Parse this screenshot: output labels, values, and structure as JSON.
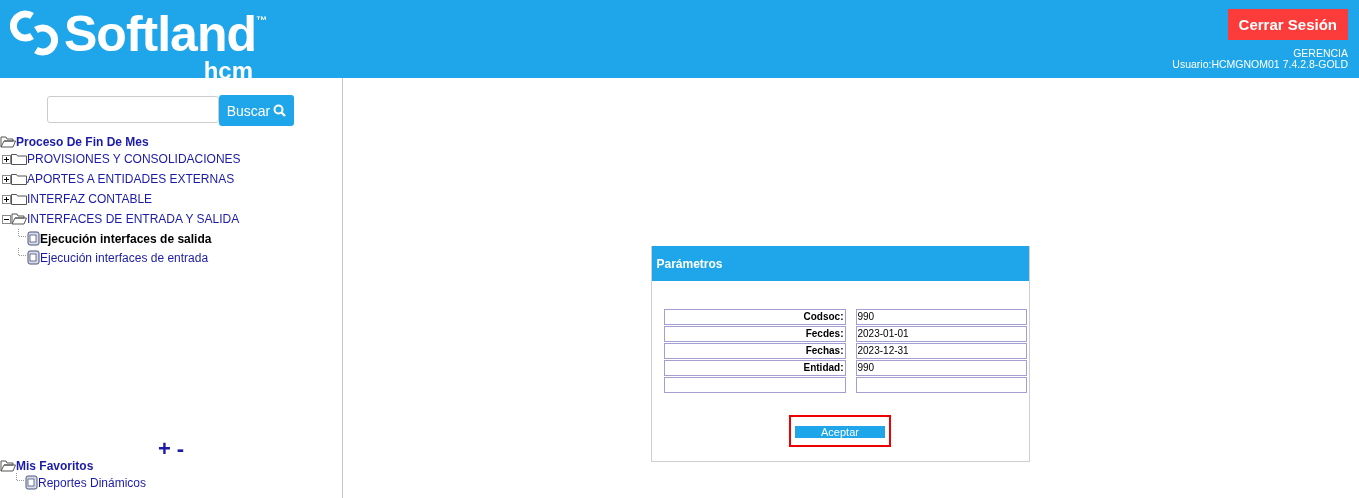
{
  "header": {
    "logo": {
      "name": "Softland",
      "trademark": "™",
      "sub": "hcm"
    },
    "logout_button": "Cerrar Sesión",
    "role": "GERENCIA",
    "user": "Usuario:HCMGNOM01 7.4.2.8-GOLD"
  },
  "sidebar": {
    "search": {
      "button": "Buscar"
    },
    "tree": {
      "label": "Proceso De Fin De Mes",
      "expanded": true,
      "children": [
        {
          "label": "PROVISIONES Y CONSOLIDACIONES",
          "kind": "folder",
          "expanded": false
        },
        {
          "label": "APORTES A ENTIDADES EXTERNAS",
          "kind": "folder",
          "expanded": false
        },
        {
          "label": "INTERFAZ CONTABLE",
          "kind": "folder",
          "expanded": false
        },
        {
          "label": "INTERFACES DE ENTRADA Y SALIDA",
          "kind": "folder",
          "expanded": true,
          "children": [
            {
              "label": "Ejecución interfaces de salida",
              "kind": "doc",
              "selected": true
            },
            {
              "label": "Ejecución interfaces de entrada",
              "kind": "doc",
              "selected": false
            }
          ]
        }
      ]
    },
    "zoom_controls": {
      "plus": "+",
      "minus": "-"
    },
    "favorites": {
      "label": "Mis Favoritos",
      "expanded": true,
      "children": [
        {
          "label": "Reportes Dinámicos",
          "kind": "doc",
          "selected": false
        }
      ]
    }
  },
  "panel": {
    "title": "Parámetros",
    "params": [
      {
        "label": "Codsoc:",
        "value": "990"
      },
      {
        "label": "Fecdes:",
        "value": "2023-01-01"
      },
      {
        "label": "Fechas:",
        "value": "2023-12-31"
      },
      {
        "label": "Entidad:",
        "value": "990"
      }
    ],
    "button": {
      "label": "Aceptar",
      "highlighted": true
    }
  }
}
